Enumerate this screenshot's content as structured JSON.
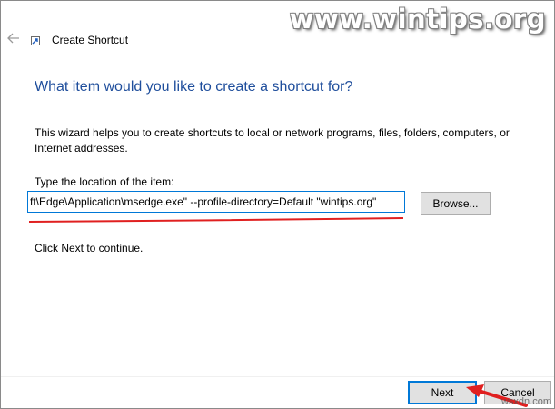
{
  "watermark": "www.wintips.org",
  "header": {
    "title": "Create Shortcut"
  },
  "main": {
    "heading": "What item would you like to create a shortcut for?",
    "intro": "This wizard helps you to create shortcuts to local or network programs, files, folders, computers, or Internet addresses.",
    "location_label": "Type the location of the item:",
    "location_value": "ft\\Edge\\Application\\msedge.exe\" --profile-directory=Default \"wintips.org\"",
    "browse_label": "Browse...",
    "hint": "Click Next to continue."
  },
  "footer": {
    "next_label": "Next",
    "cancel_label": "Cancel",
    "credit": "wsxdn.com"
  },
  "colors": {
    "heading": "#1f4e9c",
    "focus_border": "#0078d7",
    "annotation_red": "#e02020"
  },
  "icons": [
    "back-arrow-icon",
    "shortcut-icon"
  ]
}
